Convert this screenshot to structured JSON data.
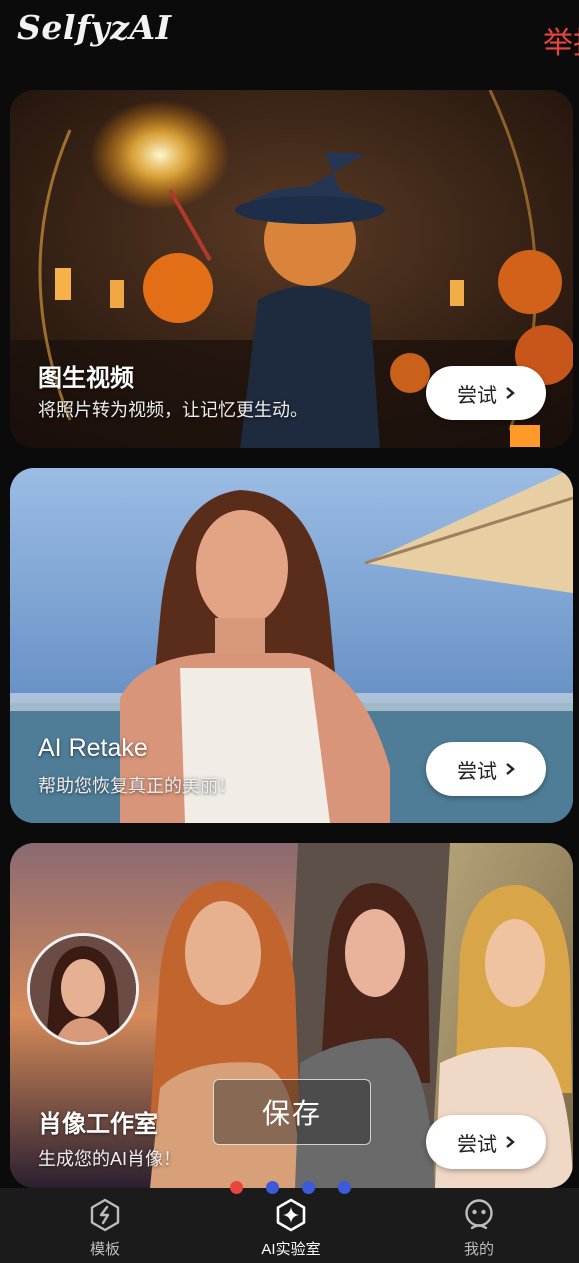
{
  "app": {
    "logo": "SelfyzAI",
    "report_label": "举报"
  },
  "cards": [
    {
      "title": "图生视频",
      "subtitle": "将照片转为视频，让记忆更生动。",
      "button": "尝试"
    },
    {
      "title": "AI Retake",
      "subtitle": "帮助您恢复真正的美丽！",
      "button": "尝试"
    },
    {
      "title": "肖像工作室",
      "subtitle": "生成您的AI肖像！",
      "button": "尝试"
    }
  ],
  "toast": {
    "label": "保存"
  },
  "page_indicator": {
    "count": 4,
    "active_index": 0,
    "active_color": "#e8453c",
    "inactive_color": "#3d5bd8"
  },
  "bottom_nav": {
    "items": [
      {
        "label": "模板",
        "icon": "template-icon"
      },
      {
        "label": "AI实验室",
        "icon": "ai-lab-icon",
        "active": true
      },
      {
        "label": "我的",
        "icon": "profile-icon"
      }
    ]
  }
}
